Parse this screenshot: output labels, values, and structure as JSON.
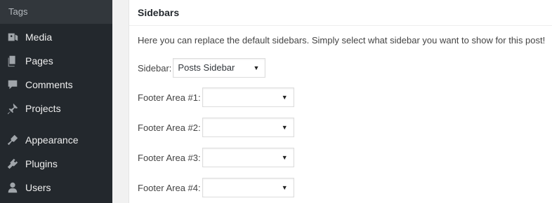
{
  "sidebar": {
    "submenu_item": "Tags",
    "items": [
      {
        "label": "Media",
        "icon": "media-icon"
      },
      {
        "label": "Pages",
        "icon": "pages-icon"
      },
      {
        "label": "Comments",
        "icon": "comments-icon"
      },
      {
        "label": "Projects",
        "icon": "projects-icon"
      },
      {
        "label": "Appearance",
        "icon": "appearance-icon"
      },
      {
        "label": "Plugins",
        "icon": "plugins-icon"
      },
      {
        "label": "Users",
        "icon": "users-icon"
      }
    ]
  },
  "panel": {
    "title": "Sidebars",
    "description": "Here you can replace the default sidebars. Simply select what sidebar you want to show for this post!",
    "sidebar_field": {
      "label": "Sidebar:",
      "value": "Posts Sidebar"
    },
    "footer_fields": [
      {
        "label": "Footer Area #1:",
        "value": ""
      },
      {
        "label": "Footer Area #2:",
        "value": ""
      },
      {
        "label": "Footer Area #3:",
        "value": ""
      },
      {
        "label": "Footer Area #4:",
        "value": ""
      }
    ]
  },
  "colors": {
    "sidebar_bg": "#23282d",
    "submenu_bg": "#32373c",
    "panel_bg": "#ffffff",
    "page_bg": "#f1f1f1"
  }
}
